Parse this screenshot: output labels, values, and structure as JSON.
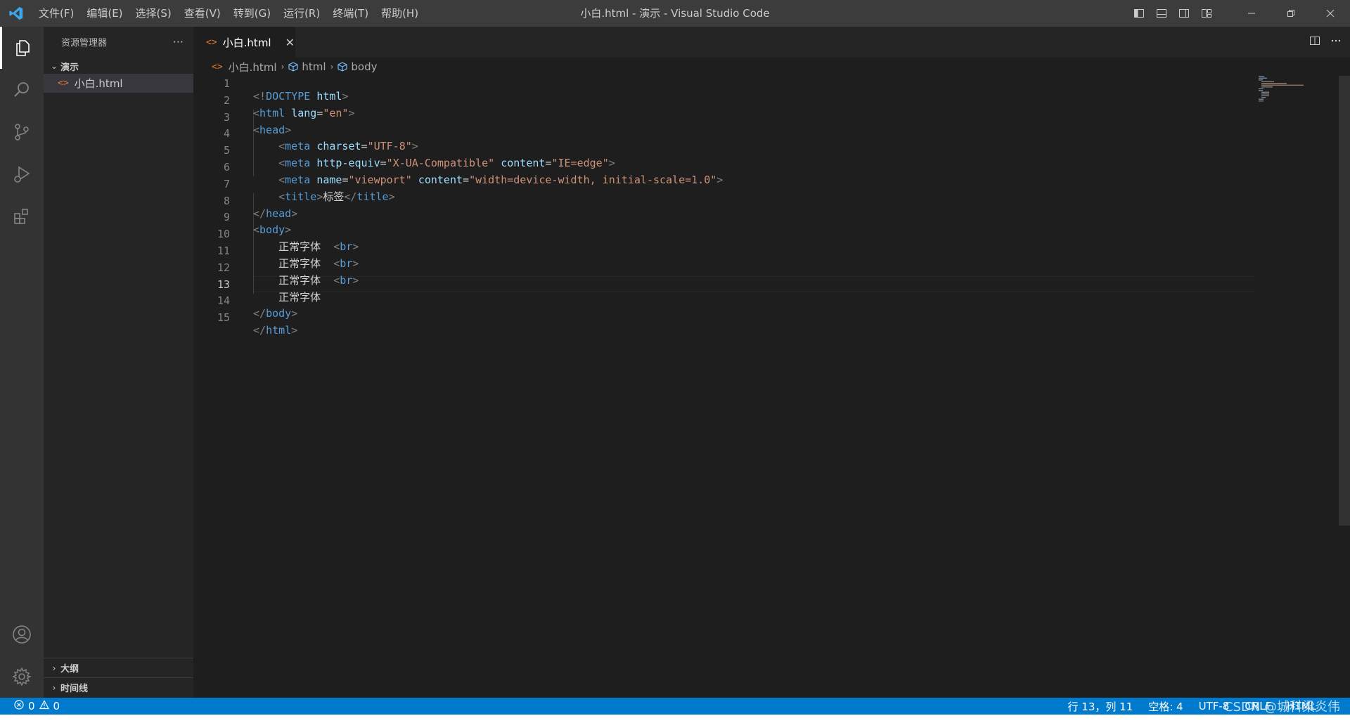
{
  "titlebar": {
    "menu": [
      "文件(F)",
      "编辑(E)",
      "选择(S)",
      "查看(V)",
      "转到(G)",
      "运行(R)",
      "终端(T)",
      "帮助(H)"
    ],
    "window_title": "小白.html - 演示 - Visual Studio Code"
  },
  "sidebar": {
    "title": "资源管理器",
    "more": "···",
    "folder": "演示",
    "file": "小白.html",
    "outline": "大纲",
    "timeline": "时间线"
  },
  "tab": {
    "label": "小白.html",
    "close": "✕"
  },
  "breadcrumb": [
    "小白.html",
    "html",
    "body"
  ],
  "editor": {
    "line_numbers": [
      "1",
      "2",
      "3",
      "4",
      "5",
      "6",
      "7",
      "8",
      "9",
      "10",
      "11",
      "12",
      "13",
      "14",
      "15"
    ],
    "current_line": 13,
    "title_text": "标签",
    "body_text": "正常字体"
  },
  "statusbar": {
    "errors": "0",
    "warnings": "0",
    "position": "行 13，列 11",
    "spaces": "空格: 4",
    "encoding": "UTF-8",
    "eol": "CRLF",
    "language": "HTML"
  },
  "watermark": "CSDN @城科梁炎伟",
  "colors": {
    "statusbar": "#007acc",
    "tag": "#569cd6",
    "attr": "#9cdcfe",
    "string": "#ce9178",
    "file_icon": "#e37933"
  }
}
